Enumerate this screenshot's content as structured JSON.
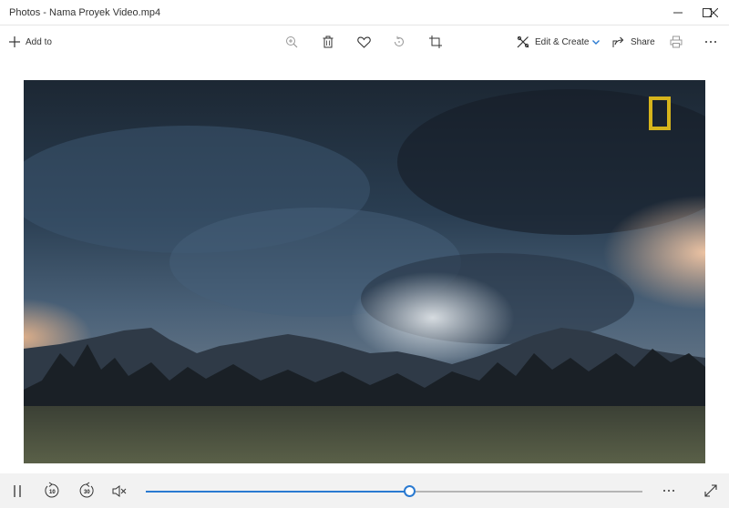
{
  "window": {
    "title": "Photos - Nama Proyek Video.mp4",
    "minimize_icon": "minimize-icon",
    "maximize_icon": "maximize-icon",
    "close_icon": "close-icon"
  },
  "toolbar": {
    "add_to_label": "Add to",
    "edit_create_label": "Edit & Create",
    "share_label": "Share",
    "accent": "#2a7ad1",
    "icons": [
      "add-icon",
      "zoom-icon",
      "delete-icon",
      "heart-icon",
      "rotate-icon",
      "crop-icon",
      "edit-icon",
      "share-icon",
      "print-icon",
      "more-icon"
    ]
  },
  "video": {
    "logo_color": "#d6b41c"
  },
  "controls": {
    "rewind_seconds": "10",
    "forward_seconds": "30",
    "progress": 0.53,
    "accent": "#2a7ad1",
    "icons": [
      "pause-icon",
      "rewind-icon",
      "forward-icon",
      "mute-icon",
      "more-icon",
      "fullscreen-icon"
    ]
  }
}
